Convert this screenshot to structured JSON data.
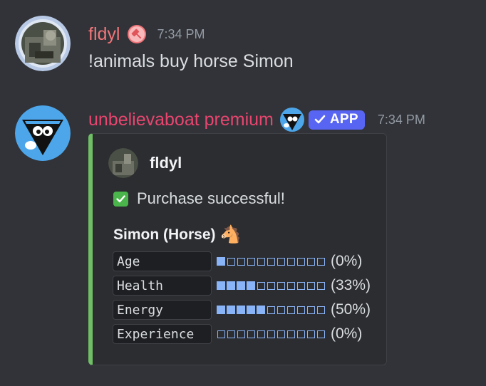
{
  "messages": [
    {
      "username": "fldyl",
      "timestamp": "7:34 PM",
      "text": "!animals buy horse Simon"
    },
    {
      "username": "unbelievaboat premium",
      "app_tag": "APP",
      "timestamp": "7:34 PM",
      "embed": {
        "author": "fldyl",
        "description": "Purchase successful!",
        "field_title": "Simon (Horse)",
        "field_emoji": "🐴",
        "stats": [
          {
            "label": "Age",
            "filled": 1,
            "total": 11,
            "percent": "(0%)"
          },
          {
            "label": "Health",
            "filled": 4,
            "total": 11,
            "percent": "(33%)"
          },
          {
            "label": "Energy",
            "filled": 5,
            "total": 11,
            "percent": "(50%)"
          },
          {
            "label": "Experience",
            "filled": 0,
            "total": 11,
            "percent": "(0%)"
          }
        ]
      }
    }
  ],
  "colors": {
    "background": "#313338",
    "embed_bg": "#2b2d31",
    "embed_accent": "#6fbf65",
    "user1": "#f1767a",
    "user2": "#e9456f",
    "app_tag": "#5865f2",
    "bar": "#8ab4f8"
  }
}
